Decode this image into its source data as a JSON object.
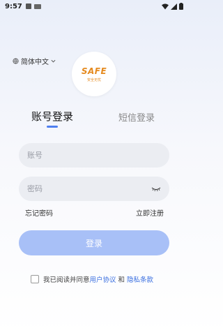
{
  "status_bar": {
    "time": "9:57"
  },
  "language": {
    "label": "简体中文"
  },
  "logo": {
    "mark": "SAFE",
    "sub": "安全无忧"
  },
  "tabs": {
    "account_login": "账号登录",
    "sms_login": "短信登录"
  },
  "form": {
    "account_placeholder": "账号",
    "password_placeholder": "密码"
  },
  "links": {
    "forgot_password": "忘记密码",
    "register": "立即注册"
  },
  "login_button": "登录",
  "agreement": {
    "prefix": "我已阅读并同意",
    "user_agreement": "用户协议",
    "and": "和",
    "privacy_policy": "隐私条款"
  },
  "colors": {
    "accent": "#4f7ff0",
    "button": "#a8c0f7",
    "link": "#3a6fe0",
    "logo": "#e58a1f"
  }
}
